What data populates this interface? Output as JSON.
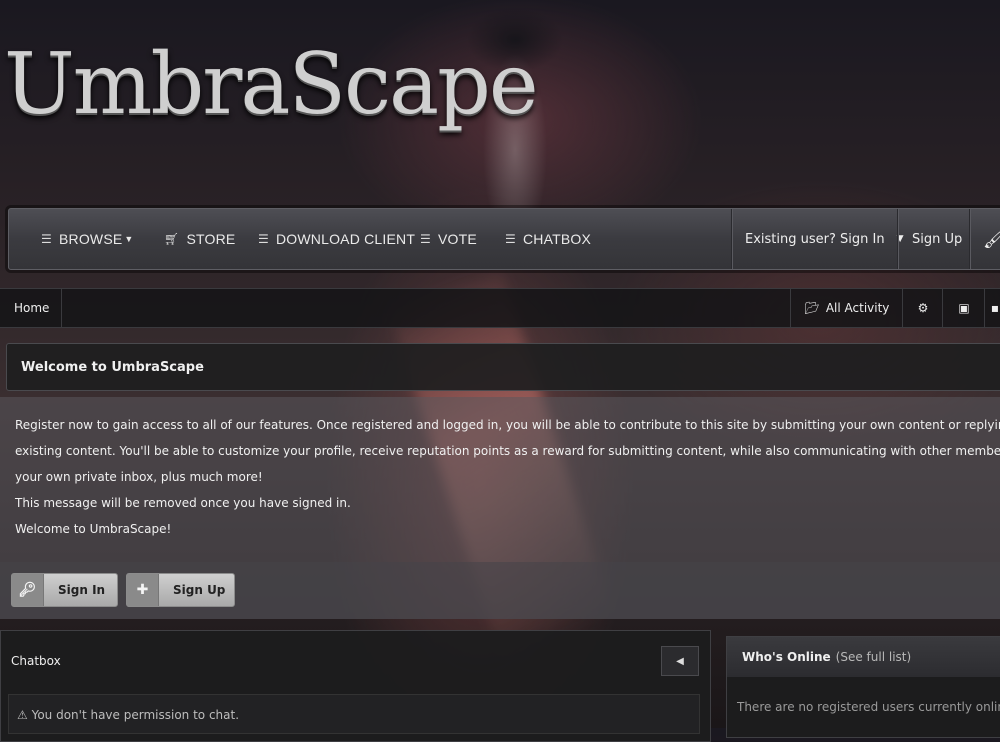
{
  "site": {
    "logo": "UmbraScape"
  },
  "nav": {
    "items": [
      {
        "label": "BROWSE",
        "icon": "list-icon",
        "dropdown": true
      },
      {
        "label": "STORE",
        "icon": "cart-icon"
      },
      {
        "label": "DOWNLOAD CLIENT",
        "icon": "menu-icon"
      },
      {
        "label": "VOTE",
        "icon": "menu-icon"
      },
      {
        "label": "CHATBOX",
        "icon": "menu-icon"
      }
    ],
    "sign_in": "Existing user? Sign In",
    "sign_up": "Sign Up"
  },
  "breadcrumb": {
    "home": "Home",
    "all_activity": "All Activity"
  },
  "welcome": {
    "title": "Welcome to UmbraScape",
    "line1": "Register now to gain access to all of our features. Once registered and logged in, you will be able to contribute to this site by submitting your own content or replying to",
    "line2": "existing content. You'll be able to customize your profile, receive reputation points as a reward for submitting content, while also communicating with other members via",
    "line3": "your own private inbox, plus much more!",
    "line4": "This message will be removed once you have signed in.",
    "line5": "Welcome to UmbraScape!",
    "sign_in_btn": "Sign In",
    "sign_up_btn": "Sign Up"
  },
  "chatbox": {
    "title": "Chatbox",
    "message": "You don't have permission to chat."
  },
  "whos_online": {
    "title": "Who's Online",
    "link": "(See full list)",
    "empty": "There are no registered users currently online"
  },
  "colors": {
    "accent": "#4e4e54",
    "background": "#2a2226"
  }
}
